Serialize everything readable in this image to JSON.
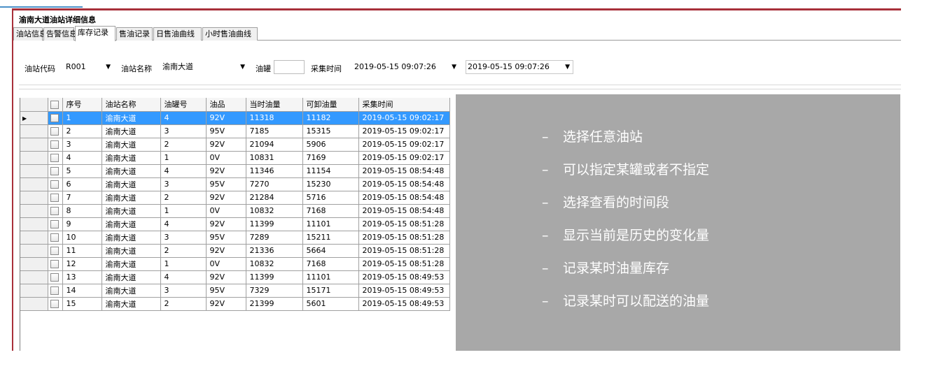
{
  "window": {
    "title": "渝南大道油站详细信息"
  },
  "tabs": [
    {
      "label": "油站信息",
      "active": false
    },
    {
      "label": "告警信息",
      "active": false
    },
    {
      "label": "库存记录",
      "active": true
    },
    {
      "label": "售油记录",
      "active": false
    },
    {
      "label": "日售油曲线",
      "active": false
    },
    {
      "label": "小时售油曲线",
      "active": false
    }
  ],
  "filter": {
    "station_code_label": "油站代码",
    "station_code_value": "R001",
    "station_name_label": "油站名称",
    "station_name_value": "渝南大道",
    "tank_label": "油罐",
    "tank_value": "",
    "time_label": "采集时间",
    "time_from": "2019-05-15 09:07:26",
    "time_to": "2019-05-15 09:07:26",
    "dropdown_glyph": "▼"
  },
  "grid": {
    "columns": [
      "序号",
      "油站名称",
      "油罐号",
      "油品",
      "当时油量",
      "可卸油量",
      "采集时间"
    ],
    "selected_marker": "▶",
    "rows": [
      [
        "1",
        "渝南大道",
        "4",
        "92V",
        "11318",
        "11182",
        "2019-05-15 09:02:17"
      ],
      [
        "2",
        "渝南大道",
        "3",
        "95V",
        "7185",
        "15315",
        "2019-05-15 09:02:17"
      ],
      [
        "3",
        "渝南大道",
        "2",
        "92V",
        "21094",
        "5906",
        "2019-05-15 09:02:17"
      ],
      [
        "4",
        "渝南大道",
        "1",
        "0V",
        "10831",
        "7169",
        "2019-05-15 09:02:17"
      ],
      [
        "5",
        "渝南大道",
        "4",
        "92V",
        "11346",
        "11154",
        "2019-05-15 08:54:48"
      ],
      [
        "6",
        "渝南大道",
        "3",
        "95V",
        "7270",
        "15230",
        "2019-05-15 08:54:48"
      ],
      [
        "7",
        "渝南大道",
        "2",
        "92V",
        "21284",
        "5716",
        "2019-05-15 08:54:48"
      ],
      [
        "8",
        "渝南大道",
        "1",
        "0V",
        "10832",
        "7168",
        "2019-05-15 08:54:48"
      ],
      [
        "9",
        "渝南大道",
        "4",
        "92V",
        "11399",
        "11101",
        "2019-05-15 08:51:28"
      ],
      [
        "10",
        "渝南大道",
        "3",
        "95V",
        "7289",
        "15211",
        "2019-05-15 08:51:28"
      ],
      [
        "11",
        "渝南大道",
        "2",
        "92V",
        "21336",
        "5664",
        "2019-05-15 08:51:28"
      ],
      [
        "12",
        "渝南大道",
        "1",
        "0V",
        "10832",
        "7168",
        "2019-05-15 08:51:28"
      ],
      [
        "13",
        "渝南大道",
        "4",
        "92V",
        "11399",
        "11101",
        "2019-05-15 08:49:53"
      ],
      [
        "14",
        "渝南大道",
        "3",
        "95V",
        "7329",
        "15171",
        "2019-05-15 08:49:53"
      ],
      [
        "15",
        "渝南大道",
        "2",
        "92V",
        "21399",
        "5601",
        "2019-05-15 08:49:53"
      ]
    ]
  },
  "annotation": {
    "dash": "–",
    "bullets": [
      "选择任意油站",
      "可以指定某罐或者不指定",
      "选择查看的时间段",
      "显示当前是历史的变化量",
      "记录某时油量库存",
      "记录某时可以配送的油量"
    ]
  },
  "colors": {
    "window_border": "#a8303a",
    "selection": "#3399ff",
    "panel": "#a8a8a8",
    "accent_line": "#4a90c8"
  }
}
